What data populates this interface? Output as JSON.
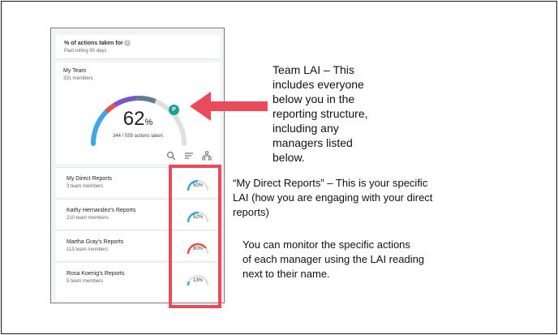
{
  "header": {
    "title": "% of actions taken for",
    "info_icon": "i",
    "subtitle": "Past rolling 90 days"
  },
  "team": {
    "title": "My Team",
    "members": "331 members",
    "percent_number": "62",
    "percent_unit": "%",
    "actions_text": "344 / 559 actions taken",
    "percent_value": 62,
    "badge_letter": "P",
    "tools": [
      "search-icon",
      "filter-icon",
      "org-chart-icon"
    ]
  },
  "reports": [
    {
      "name": "My Direct Reports",
      "members": "3 team members",
      "percent_label": "50%",
      "value": 50
    },
    {
      "name": "Kathy Hernandez's Reports",
      "members": "210 team members",
      "percent_label": "52%",
      "value": 52
    },
    {
      "name": "Martha Gray's Reports",
      "members": "113 team members",
      "percent_label": "80%",
      "value": 80
    },
    {
      "name": "Rosa Koenig's Reports",
      "members": "5 team members",
      "percent_label": "13%",
      "value": 13
    }
  ],
  "annotations": {
    "team_lai": [
      "Team LAI – This",
      "includes everyone",
      "below you in the",
      "reporting structure,",
      "including any",
      "managers listed",
      "below."
    ],
    "direct_reports": [
      "“My Direct Reports” – This is your specific",
      "LAI (how you are engaging with your direct",
      "reports)"
    ],
    "monitor": [
      "You can monitor the specific actions",
      "of each manager using the LAI reading",
      "next to their name."
    ]
  },
  "colors": {
    "gauge_blue": "#3fa6e8",
    "gauge_red": "#e5534b",
    "gauge_purple": "#7a57c9",
    "gauge_slate": "#5f7d8c",
    "gauge_track": "#e0e0e0",
    "teal": "#17a094",
    "highlight": "#ea4a5a"
  }
}
